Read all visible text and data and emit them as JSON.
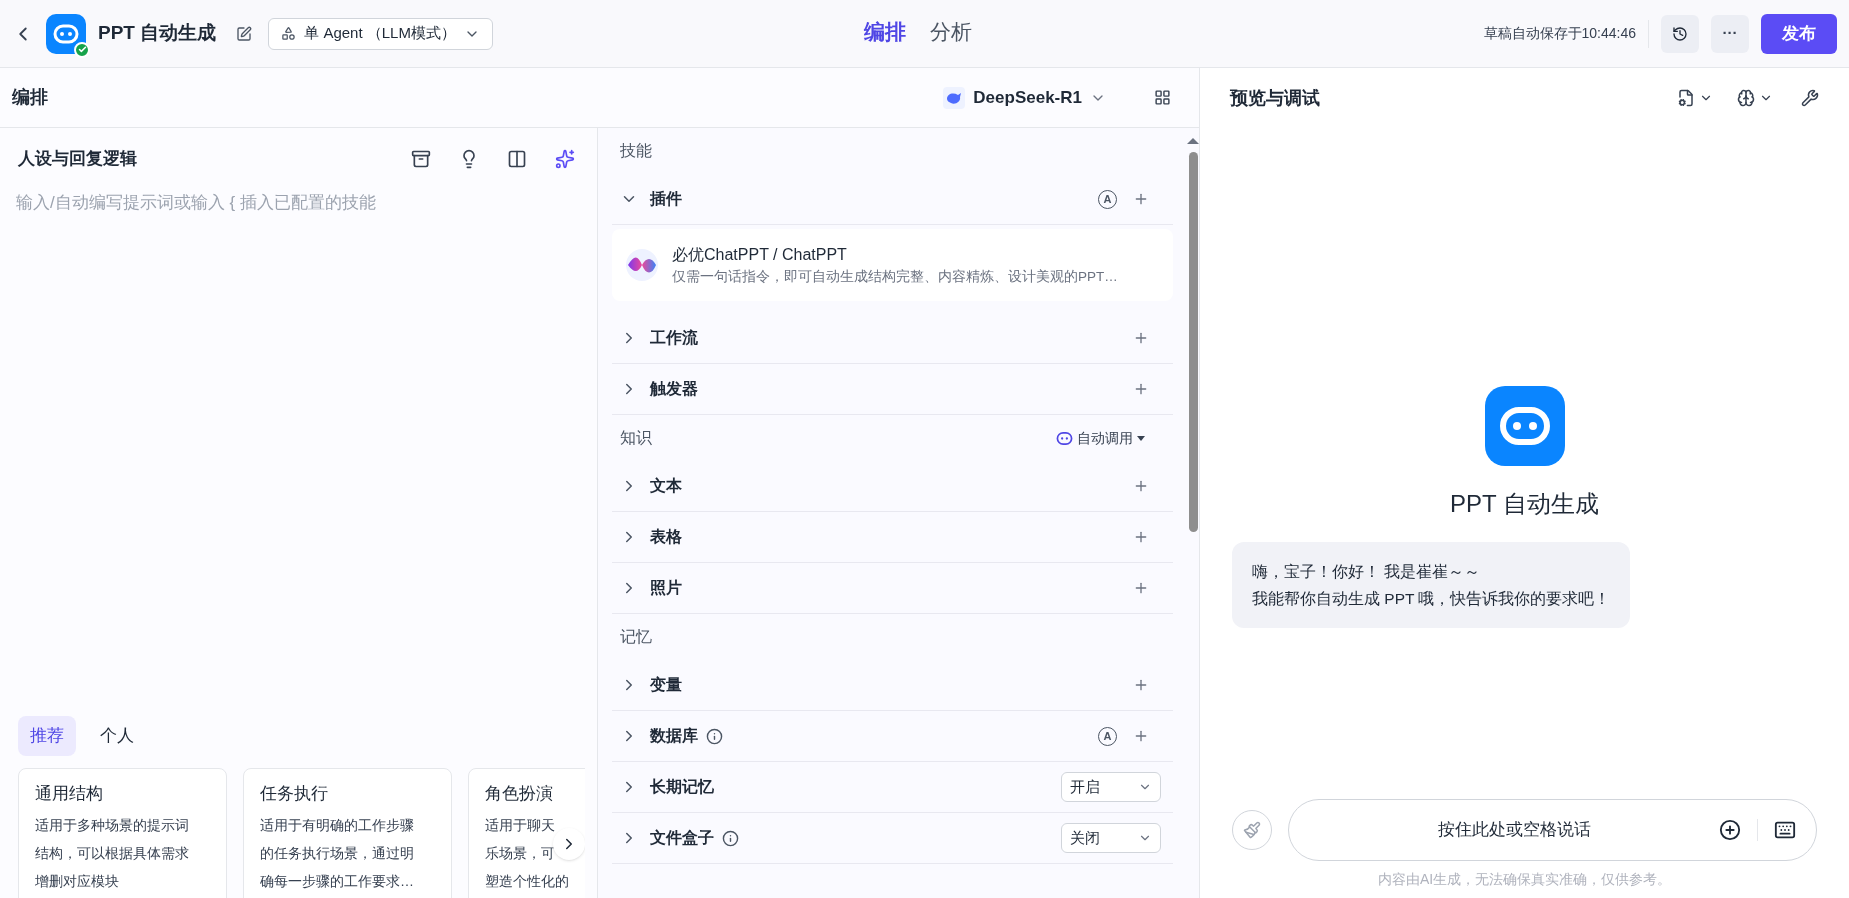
{
  "top_bar": {
    "title": "PPT 自动生成",
    "mode_select": "单 Agent （LLM模式）",
    "tabs": [
      {
        "label": "编排",
        "selected": true
      },
      {
        "label": "分析",
        "selected": false
      }
    ],
    "save_status": "草稿自动保存于10:44:46",
    "more": "···",
    "publish": "发布"
  },
  "arrange_header": {
    "title": "编排",
    "model": "DeepSeek-R1"
  },
  "prompt_panel": {
    "title": "人设与回复逻辑",
    "placeholder": "输入/自动编写提示词或输入 { 插入已配置的技能",
    "template_tabs": [
      {
        "label": "推荐",
        "selected": true
      },
      {
        "label": "个人",
        "selected": false
      }
    ],
    "templates": [
      {
        "title": "通用结构",
        "lines": [
          "适用于多种场景的提示词",
          "结构，可以根据具体需求",
          "增删对应模块"
        ]
      },
      {
        "title": "任务执行",
        "lines": [
          "适用于有明确的工作步骤",
          "的任务执行场景，通过明",
          "确每一步骤的工作要求…"
        ]
      },
      {
        "title": "角色扮演",
        "lines": [
          "适用于聊天",
          "乐场景，可",
          "塑造个性化的"
        ]
      }
    ]
  },
  "sections": [
    {
      "title": "技能",
      "items": [
        {
          "kind": "add",
          "label": "插件",
          "expanded": true,
          "badge": "A",
          "info": false,
          "children": [
            {
              "name": "必优ChatPPT / ChatPPT",
              "description": "仅需一句话指令，即可自动生成结构完整、内容精炼、设计美观的PPT…"
            }
          ]
        },
        {
          "kind": "add",
          "label": "工作流",
          "expanded": false,
          "info": false
        },
        {
          "kind": "add",
          "label": "触发器",
          "expanded": false,
          "info": false
        }
      ]
    },
    {
      "title": "知识",
      "mode": "自动调用",
      "items": [
        {
          "kind": "add",
          "label": "文本",
          "expanded": false,
          "info": false
        },
        {
          "kind": "add",
          "label": "表格",
          "expanded": false,
          "info": false
        },
        {
          "kind": "add",
          "label": "照片",
          "expanded": false,
          "info": false
        }
      ]
    },
    {
      "title": "记忆",
      "items": [
        {
          "kind": "add",
          "label": "变量",
          "expanded": false,
          "info": false
        },
        {
          "kind": "add",
          "label": "数据库",
          "expanded": false,
          "badge": "A",
          "info": true
        },
        {
          "kind": "select",
          "label": "长期记忆",
          "expanded": false,
          "info": false,
          "value": "开启"
        },
        {
          "kind": "select",
          "label": "文件盒子",
          "expanded": false,
          "info": true,
          "value": "关闭"
        }
      ]
    }
  ],
  "preview": {
    "title": "预览与调试",
    "bot_name": "PPT 自动生成",
    "greeting": [
      "嗨，宝子！你好！ 我是崔崔～～",
      "我能帮你自动生成 PPT 哦，快告诉我你的要求吧！"
    ],
    "voice_button": "按住此处或空格说话",
    "disclaimer": "内容由AI生成，无法确保真实准确，仅供参考。"
  }
}
